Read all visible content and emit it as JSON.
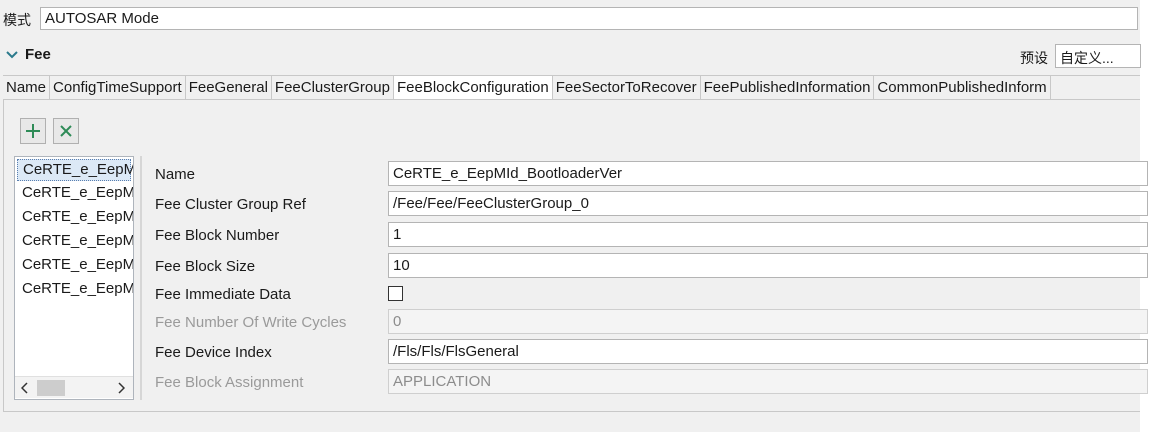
{
  "mode": {
    "label": "模式",
    "value": "AUTOSAR Mode"
  },
  "section": {
    "title": "Fee",
    "expanded_icon": "chevron-down-icon"
  },
  "preset": {
    "label": "预设",
    "value": "自定义..."
  },
  "tabs": [
    {
      "label": "Name"
    },
    {
      "label": "ConfigTimeSupport"
    },
    {
      "label": "FeeGeneral"
    },
    {
      "label": "FeeClusterGroup"
    },
    {
      "label": "FeeBlockConfiguration",
      "active": true
    },
    {
      "label": "FeeSectorToRecover"
    },
    {
      "label": "FeePublishedInformation"
    },
    {
      "label": "CommonPublishedInform"
    }
  ],
  "toolbar": {
    "add_icon": "plus-icon",
    "remove_icon": "close-icon",
    "accent": "#2e8b57"
  },
  "block_list": [
    "CeRTE_e_EepM",
    "CeRTE_e_EepM",
    "CeRTE_e_EepM",
    "CeRTE_e_EepM",
    "CeRTE_e_EepM",
    "CeRTE_e_EepM"
  ],
  "scroll": {
    "left_icon": "chevron-left-icon",
    "right_icon": "chevron-right-icon"
  },
  "properties": {
    "name": {
      "label": "Name",
      "value": "CeRTE_e_EepMId_BootloaderVer"
    },
    "cluster_group_ref": {
      "label": "Fee Cluster Group Ref",
      "value": "/Fee/Fee/FeeClusterGroup_0"
    },
    "block_number": {
      "label": "Fee Block Number",
      "value": "1"
    },
    "block_size": {
      "label": "Fee Block Size",
      "value": "10"
    },
    "immediate_data": {
      "label": "Fee Immediate Data",
      "checked": false
    },
    "write_cycles": {
      "label": "Fee Number Of Write Cycles",
      "value": "0"
    },
    "device_index": {
      "label": "Fee Device Index",
      "value": "/Fls/Fls/FlsGeneral"
    },
    "block_assignment": {
      "label": "Fee Block Assignment",
      "value": "APPLICATION"
    }
  }
}
